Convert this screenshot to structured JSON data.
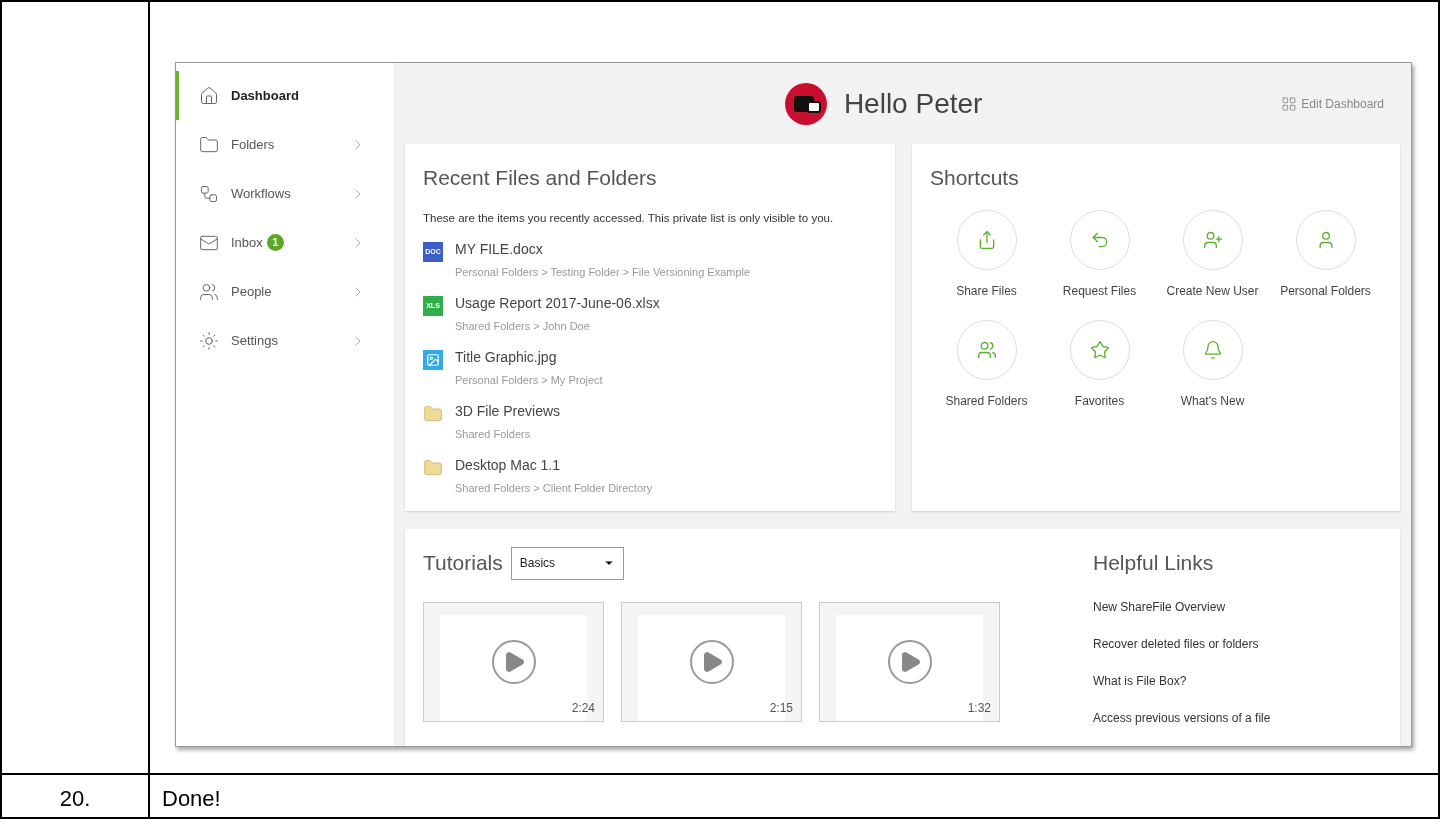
{
  "step": {
    "number": "20.",
    "text": "Done!"
  },
  "sidebar": {
    "items": [
      {
        "kind": "home",
        "label": "Dashboard",
        "selected": true,
        "expandable": false
      },
      {
        "kind": "folder",
        "label": "Folders",
        "selected": false,
        "expandable": true
      },
      {
        "kind": "workflow",
        "label": "Workflows",
        "selected": false,
        "expandable": true
      },
      {
        "kind": "mail",
        "label": "Inbox",
        "badge": "1",
        "selected": false,
        "expandable": true
      },
      {
        "kind": "people",
        "label": "People",
        "selected": false,
        "expandable": true
      },
      {
        "kind": "settings",
        "label": "Settings",
        "selected": false,
        "expandable": true
      }
    ]
  },
  "header": {
    "greeting": "Hello Peter",
    "edit_link": "Edit Dashboard"
  },
  "recent": {
    "title": "Recent Files and Folders",
    "description": "These are the items you recently accessed. This private list is only visible to you.",
    "items": [
      {
        "kind": "doc",
        "icon_label": "DOC",
        "name": "MY FILE.docx",
        "path": "Personal Folders > Testing Folder > File Versioning Example"
      },
      {
        "kind": "xls",
        "icon_label": "XLS",
        "name": "Usage Report 2017-June-06.xlsx",
        "path": "Shared Folders > John Doe"
      },
      {
        "kind": "image",
        "name": "Title Graphic.jpg",
        "path": "Personal Folders > My Project"
      },
      {
        "kind": "folder",
        "name": "3D File Previews",
        "path": "Shared Folders"
      },
      {
        "kind": "folder",
        "name": "Desktop Mac 1.1",
        "path": "Shared Folders > Client Folder Directory"
      }
    ]
  },
  "shortcuts": {
    "title": "Shortcuts",
    "items": [
      {
        "kind": "share",
        "label": "Share Files"
      },
      {
        "kind": "request",
        "label": "Request Files"
      },
      {
        "kind": "add-user",
        "label": "Create New User"
      },
      {
        "kind": "user",
        "label": "Personal Folders"
      },
      {
        "kind": "users",
        "label": "Shared Folders"
      },
      {
        "kind": "star",
        "label": "Favorites"
      },
      {
        "kind": "bell",
        "label": "What's New"
      }
    ]
  },
  "tutorials": {
    "title": "Tutorials",
    "filter": "Basics",
    "videos": [
      {
        "duration": "2:24"
      },
      {
        "duration": "2:15"
      },
      {
        "duration": "1:32"
      }
    ]
  },
  "helpful_links": {
    "title": "Helpful Links",
    "links": [
      "New ShareFile Overview",
      "Recover deleted files or folders",
      "What is File Box?",
      "Access previous versions of a file"
    ]
  }
}
